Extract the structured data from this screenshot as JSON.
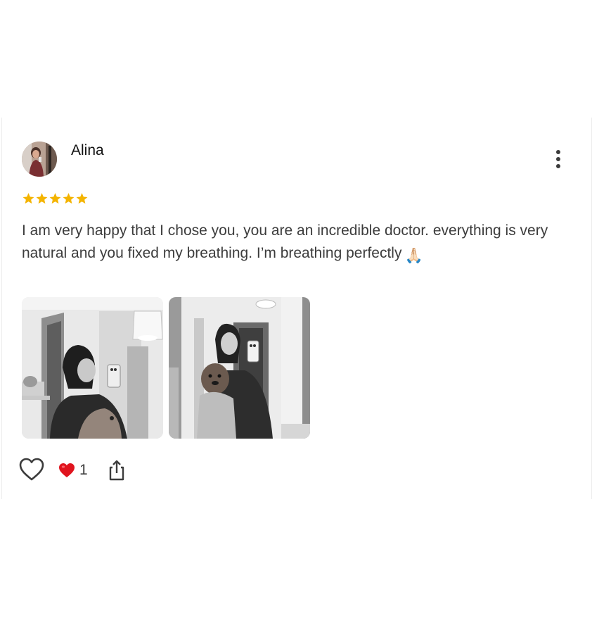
{
  "review": {
    "author": {
      "name": "Alina",
      "avatar_icon": "user-avatar-photo"
    },
    "rating": {
      "value": 5,
      "max": 5,
      "star_color": "#f4b400",
      "icon": "star-icon"
    },
    "text": "I am very happy that I chose you, you are an incredible doctor. everything is very natural and you fixed my breathing. I’m breathing perfectly",
    "text_emoji": "🙏🏻",
    "photos": [
      {
        "icon": "review-photo-1"
      },
      {
        "icon": "review-photo-2"
      }
    ],
    "actions": {
      "like_icon": "heart-outline-icon",
      "reaction_icon": "red-heart-icon",
      "reaction_count": "1",
      "share_icon": "share-icon"
    },
    "menu_icon": "more-vertical-icon"
  }
}
